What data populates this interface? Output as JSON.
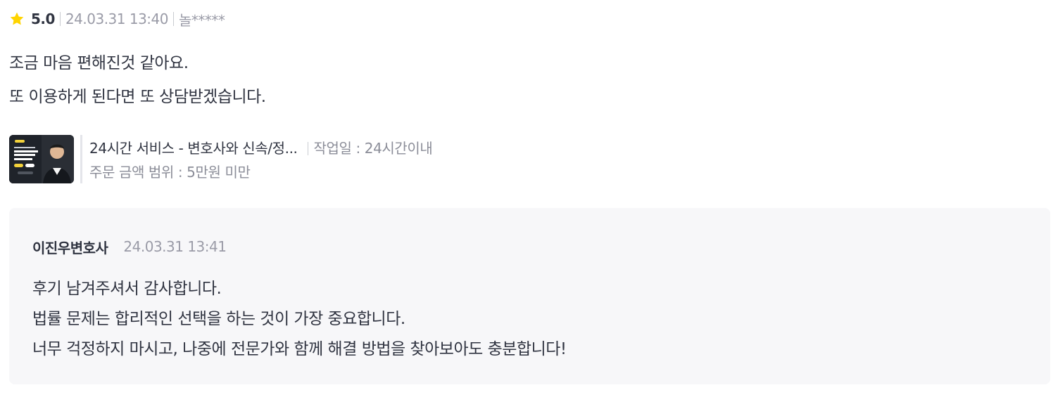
{
  "review": {
    "rating": "5.0",
    "date": "24.03.31 13:40",
    "author": "놀*****",
    "star_color": "#FFD400",
    "body_lines": [
      "조금 마음 편해진것 같아요.",
      "또 이용하게 된다면 또 상담받겠습니다."
    ]
  },
  "service": {
    "title": "24시간 서비스 - 변호사와 신속/정...",
    "work_period": "작업일 : 24시간이내",
    "price_range": "주문 금액 범위 : 5만원 미만",
    "thumb_icon": "lawyer-portrait-thumbnail"
  },
  "reply": {
    "author": "이진우변호사",
    "date": "24.03.31 13:41",
    "lines": [
      "후기 남겨주셔서 감사합니다.",
      "법률 문제는 합리적인 선택을 하는 것이 가장 중요합니다.",
      "너무 걱정하지 마시고, 나중에 전문가와 함께 해결 방법을 찾아보아도 충분합니다!"
    ]
  }
}
